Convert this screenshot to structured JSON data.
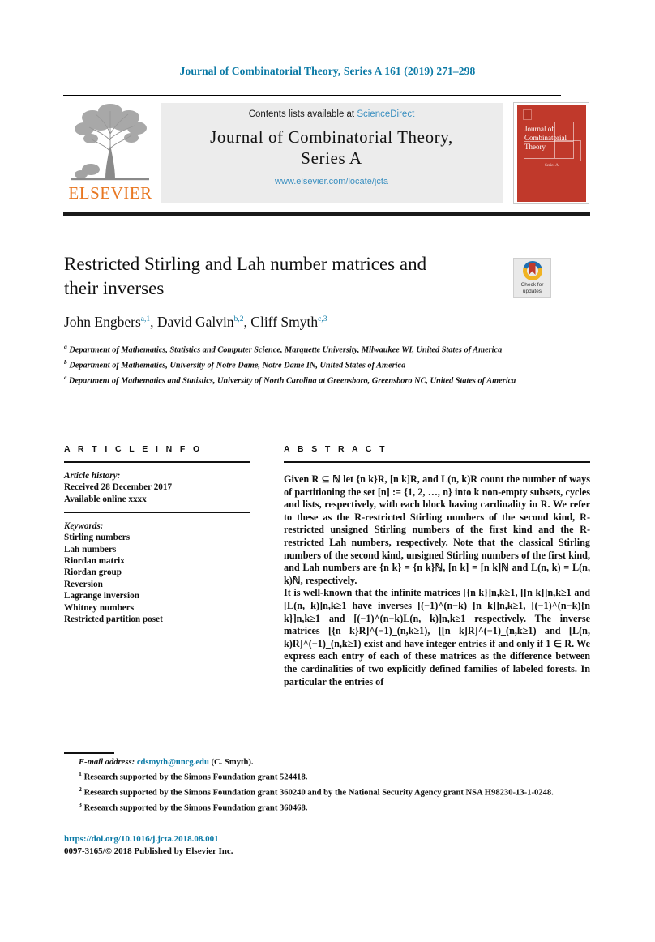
{
  "running_head": "Journal of Combinatorial Theory, Series A 161 (2019) 271–298",
  "banner": {
    "publisher_name": "ELSEVIER",
    "publisher_logo_icon": "elsevier-tree-icon",
    "contents_prefix": "Contents lists available at ",
    "contents_link": "ScienceDirect",
    "journal_title_line1": "Journal of Combinatorial Theory,",
    "journal_title_line2": "Series A",
    "journal_url": "www.elsevier.com/locate/jcta",
    "cover": {
      "line1": "Journal of",
      "line2": "Combinatorial",
      "line3": "Theory",
      "series_label": "Series A",
      "seal_icon": "publisher-seal-icon",
      "color": "#c0392b"
    }
  },
  "article": {
    "title": "Restricted Stirling and Lah number matrices and their inverses",
    "crossmark": {
      "label_line1": "Check for",
      "label_line2": "updates",
      "icon": "crossmark-badge-icon"
    },
    "authors": [
      {
        "name": "John Engbers",
        "marks": "a,1"
      },
      {
        "name": "David Galvin",
        "marks": "b,2"
      },
      {
        "name": "Cliff Smyth",
        "marks": "c,3"
      }
    ],
    "affiliations": [
      {
        "mark": "a",
        "text": "Department of Mathematics, Statistics and Computer Science, Marquette University, Milwaukee WI, United States of America"
      },
      {
        "mark": "b",
        "text": "Department of Mathematics, University of Notre Dame, Notre Dame IN, United States of America"
      },
      {
        "mark": "c",
        "text": "Department of Mathematics and Statistics, University of North Carolina at Greensboro, Greensboro NC, United States of America"
      }
    ]
  },
  "article_info": {
    "heading": "A R T I C L E   I N F O",
    "history_label": "Article history:",
    "history": [
      "Received 28 December 2017",
      "Available online xxxx"
    ],
    "keywords_label": "Keywords:",
    "keywords": [
      "Stirling numbers",
      "Lah numbers",
      "Riordan matrix",
      "Riordan group",
      "Reversion",
      "Lagrange inversion",
      "Whitney numbers",
      "Restricted partition poset"
    ]
  },
  "abstract": {
    "heading": "A B S T R A C T",
    "paragraph1": "Given R ⊆ ℕ let {n k}R, [n k]R, and L(n, k)R count the number of ways of partitioning the set [n] := {1, 2, …, n} into k non-empty subsets, cycles and lists, respectively, with each block having cardinality in R. We refer to these as the R-restricted Stirling numbers of the second kind, R-restricted unsigned Stirling numbers of the first kind and the R-restricted Lah numbers, respectively. Note that the classical Stirling numbers of the second kind, unsigned Stirling numbers of the first kind, and Lah numbers are {n k} = {n k}ℕ, [n k] = [n k]ℕ and L(n, k) = L(n, k)ℕ, respectively.",
    "paragraph2": "It is well-known that the infinite matrices [{n k}]n,k≥1, [[n k]]n,k≥1 and [L(n, k)]n,k≥1 have inverses [(−1)^(n−k) [n k]]n,k≥1, [(−1)^(n−k){n k}]n,k≥1 and [(−1)^(n−k)L(n, k)]n,k≥1 respectively. The inverse matrices [{n k}R]^(−1)_(n,k≥1), [[n k]R]^(−1)_(n,k≥1) and [L(n, k)R]^(−1)_(n,k≥1) exist and have integer entries if and only if 1 ∈ R. We express each entry of each of these matrices as the difference between the cardinalities of two explicitly defined families of labeled forests. In particular the entries of"
  },
  "footnotes": {
    "email_label": "E-mail address:",
    "email": "cdsmyth@uncg.edu",
    "email_suffix": "(C. Smyth).",
    "notes": [
      {
        "mark": "1",
        "text": "Research supported by the Simons Foundation grant 524418."
      },
      {
        "mark": "2",
        "text": "Research supported by the Simons Foundation grant 360240 and by the National Security Agency grant NSA H98230-13-1-0248."
      },
      {
        "mark": "3",
        "text": "Research supported by the Simons Foundation grant 360468."
      }
    ]
  },
  "footer": {
    "doi": "https://doi.org/10.1016/j.jcta.2018.08.001",
    "copyright": "0097-3165/© 2018 Published by Elsevier Inc."
  },
  "colors": {
    "link": "#0b7aa6",
    "elsevier_orange": "#e87722",
    "cover_red": "#c0392b",
    "banner_grey": "#ececec"
  }
}
